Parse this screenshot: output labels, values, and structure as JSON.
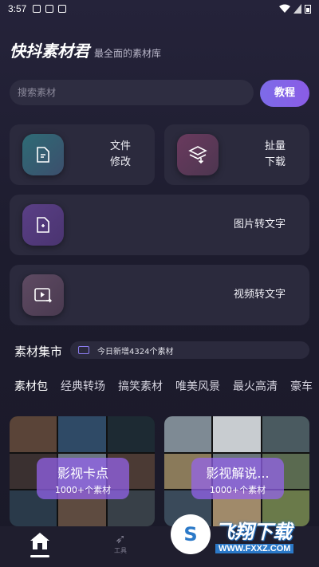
{
  "status_bar": {
    "time": "3:57"
  },
  "header": {
    "title": "快抖素材君",
    "subtitle": "最全面的素材库"
  },
  "search": {
    "placeholder": "搜索素材",
    "tutorial_label": "教程"
  },
  "features": {
    "file_edit": {
      "line1": "文件",
      "line2": "修改"
    },
    "batch_download": {
      "line1": "扯量",
      "line2": "下载"
    },
    "image_to_text": {
      "label": "图片转文字"
    },
    "video_to_text": {
      "label": "视频转文字"
    }
  },
  "market": {
    "title": "素材集市",
    "notice": "今日新增4324个素材"
  },
  "tabs": [
    {
      "label": "素材包",
      "active": true
    },
    {
      "label": "经典转场"
    },
    {
      "label": "搞笑素材"
    },
    {
      "label": "唯美风景"
    },
    {
      "label": "最火高清"
    },
    {
      "label": "豪车"
    }
  ],
  "packs": [
    {
      "title": "影视卡点",
      "count": "1000+个素材"
    },
    {
      "title": "影视解说...",
      "count": "1000+个素材"
    }
  ],
  "bottom_nav": {
    "tools_label": "工具"
  },
  "watermark": {
    "text": "飞翔下载",
    "url": "WWW.FXXZ.COM"
  },
  "colors": {
    "accent": "#8a6ef0",
    "background": "#1d1c2e",
    "card": "#2b2a3d"
  }
}
